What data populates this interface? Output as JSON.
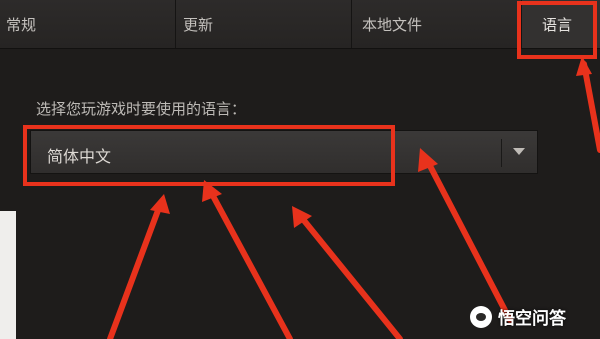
{
  "tabs": [
    {
      "label": "常规"
    },
    {
      "label": "更新"
    },
    {
      "label": "本地文件"
    },
    {
      "label": "语言",
      "active": true
    }
  ],
  "language_setting": {
    "prompt": "选择您玩游戏时要使用的语言：",
    "selected_value": "简体中文"
  },
  "icons": {
    "dropdown": "chevron-down-icon",
    "watermark": "wukong-logo-icon"
  },
  "annotation": {
    "color": "#e8321c"
  },
  "watermark": {
    "text": "悟空问答"
  }
}
